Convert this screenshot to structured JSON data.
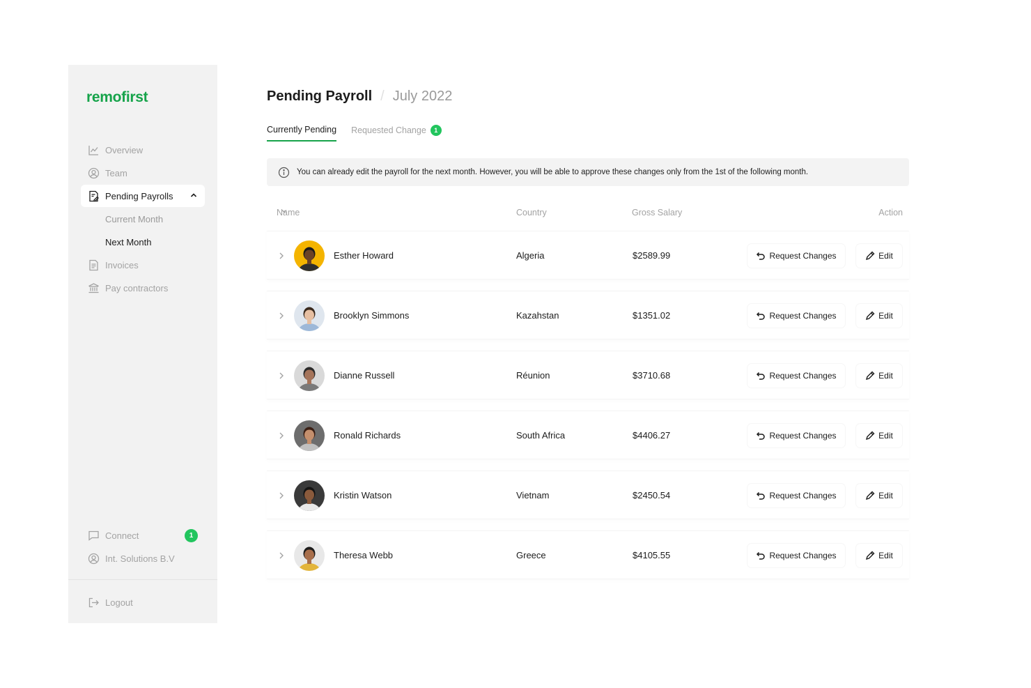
{
  "brand": {
    "logo_text": "remofirst",
    "accent_color": "#16a34a",
    "badge_color": "#22c55e"
  },
  "sidebar": {
    "items": [
      {
        "label": "Overview",
        "icon": "chart-line-icon"
      },
      {
        "label": "Team",
        "icon": "user-circle-icon"
      },
      {
        "label": "Pending Payrolls",
        "icon": "document-pen-icon",
        "active": true,
        "expanded": true,
        "children": [
          {
            "label": "Current Month"
          },
          {
            "label": "Next Month",
            "selected": true
          }
        ]
      },
      {
        "label": "Invoices",
        "icon": "invoice-icon"
      },
      {
        "label": "Pay contractors",
        "icon": "bank-icon"
      }
    ],
    "bottom": [
      {
        "label": "Connect",
        "icon": "chat-icon",
        "badge": "1"
      },
      {
        "label": "Int. Solutions B.V",
        "icon": "user-circle-icon"
      }
    ],
    "logout": {
      "label": "Logout",
      "icon": "logout-icon"
    }
  },
  "header": {
    "title": "Pending Payroll",
    "separator": "/",
    "subtitle": "July 2022"
  },
  "tabs": [
    {
      "label": "Currently Pending",
      "active": true
    },
    {
      "label": "Requested Change",
      "badge": "1"
    }
  ],
  "info_banner": {
    "icon": "info-icon",
    "text": "You can already edit the payroll for the next month. However, you will be able to approve these changes only from the 1st of the following month."
  },
  "table": {
    "columns": {
      "name": "Name",
      "country": "Country",
      "salary": "Gross Salary",
      "action": "Action"
    },
    "request_label": "Request Changes",
    "edit_label": "Edit",
    "rows": [
      {
        "name": "Esther Howard",
        "country": "Algeria",
        "salary": "$2589.99",
        "avatar_bg": "#f4b400",
        "skin": "#6b4226",
        "hair": "#1a1a1a",
        "shirt": "#2f2f2f"
      },
      {
        "name": "Brooklyn Simmons",
        "country": "Kazahstan",
        "salary": "$1351.02",
        "avatar_bg": "#dfe6ee",
        "skin": "#e6bfa2",
        "hair": "#3a2a1e",
        "shirt": "#9db8d8"
      },
      {
        "name": "Dianne Russell",
        "country": "Réunion",
        "salary": "$3710.68",
        "avatar_bg": "#d9d9d9",
        "skin": "#a5745a",
        "hair": "#2b2b2b",
        "shirt": "#7a7a7a"
      },
      {
        "name": "Ronald Richards",
        "country": "South Africa",
        "salary": "$4406.27",
        "avatar_bg": "#6d6d6d",
        "skin": "#c48f6d",
        "hair": "#3b1f14",
        "shirt": "#c0c0c0"
      },
      {
        "name": "Kristin Watson",
        "country": "Vietnam",
        "salary": "$2450.54",
        "avatar_bg": "#3a3a3a",
        "skin": "#8a5a3c",
        "hair": "#141414",
        "shirt": "#e9e9e9"
      },
      {
        "name": "Theresa Webb",
        "country": "Greece",
        "salary": "$4105.55",
        "avatar_bg": "#e8e8e8",
        "skin": "#a86f4c",
        "hair": "#1d1d1d",
        "shirt": "#e3b53b"
      }
    ]
  }
}
